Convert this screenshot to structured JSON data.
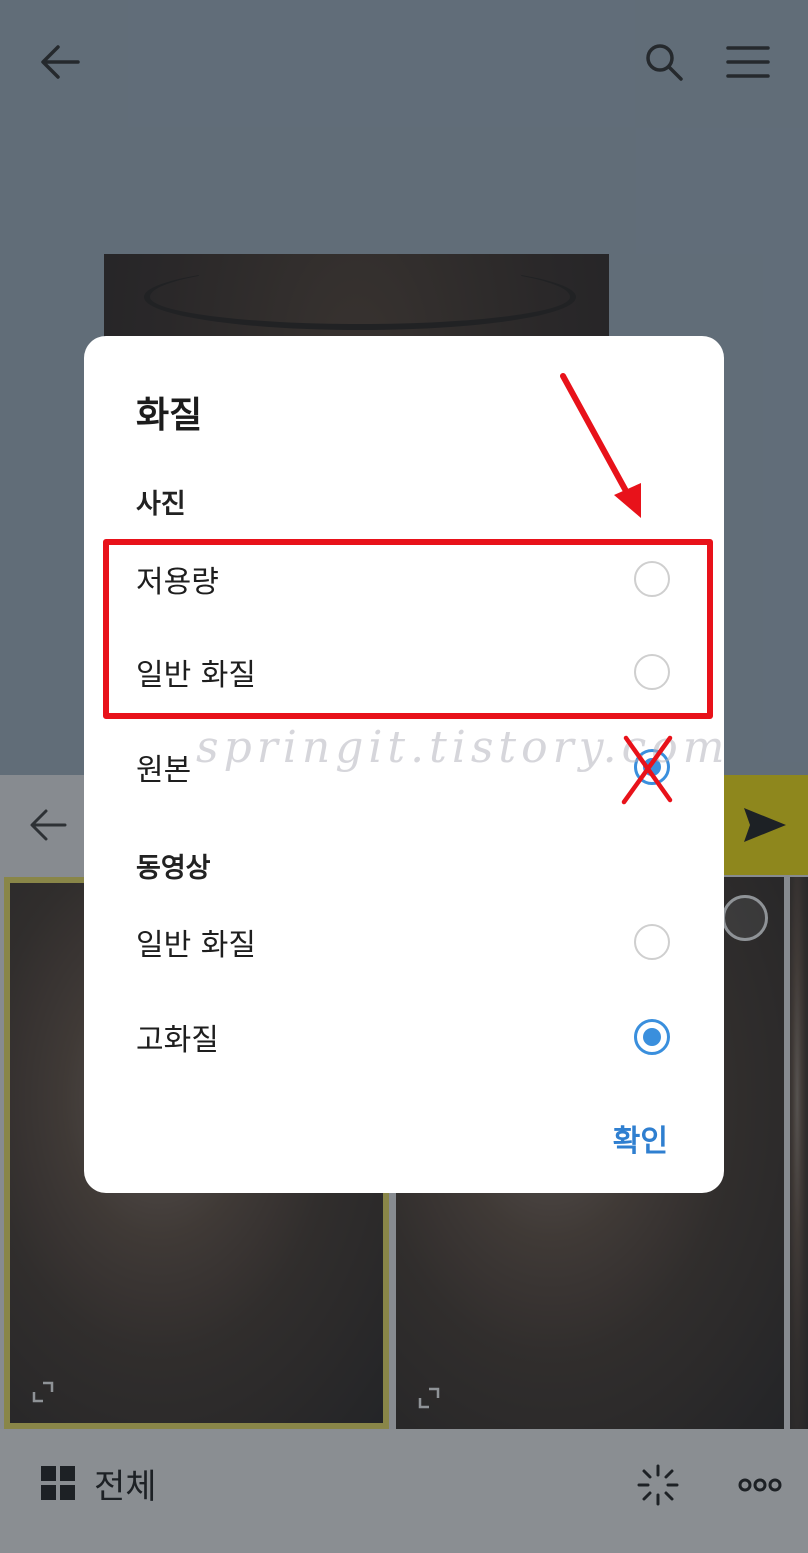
{
  "dialog": {
    "title": "화질",
    "photo_section": {
      "label": "사진",
      "options": [
        {
          "label": "저용량",
          "selected": false
        },
        {
          "label": "일반 화질",
          "selected": false
        },
        {
          "label": "원본",
          "selected": true
        }
      ]
    },
    "video_section": {
      "label": "동영상",
      "options": [
        {
          "label": "일반 화질",
          "selected": false
        },
        {
          "label": "고화질",
          "selected": true
        }
      ]
    },
    "confirm_label": "확인"
  },
  "bottom_bar": {
    "all_label": "전체"
  },
  "watermark": "springit.tistory.com",
  "colors": {
    "accent_blue": "#3a8fdd",
    "send_yellow": "#fde500",
    "annotation_red": "#e8121a"
  },
  "icons": {
    "header": [
      "back-arrow-icon",
      "search-icon",
      "menu-icon"
    ],
    "send_bar": [
      "back-arrow-icon",
      "send-icon"
    ],
    "bottom_bar": [
      "grid-icon",
      "magic-wand-icon",
      "more-icon"
    ]
  }
}
